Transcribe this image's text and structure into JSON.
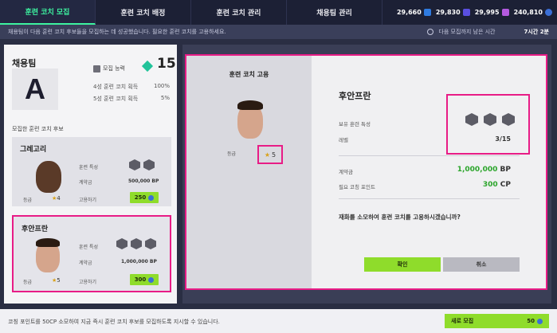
{
  "tabs": [
    "훈련 코치 모집",
    "훈련 코치 배정",
    "훈련 코치 관리",
    "채용팀 관리"
  ],
  "currencies": [
    {
      "value": "29,660",
      "icon": "bp-icon",
      "color": "#2f7be0"
    },
    {
      "value": "29,830",
      "icon": "fc-icon",
      "color": "#5a4fe0"
    },
    {
      "value": "29,995",
      "icon": "mc-icon",
      "color": "#b45ae0"
    },
    {
      "value": "240,810",
      "icon": "cp-icon",
      "color": "#3b6fd6"
    }
  ],
  "info": {
    "message": "채용팀이 다음 훈련 코치 후보들을 모집하는 데 성공했습니다. 필요한 훈련 코치를 고용하세요.",
    "timer_label": "다음 모집까지 남은 시간",
    "timer_value": "7시간 2분"
  },
  "team": {
    "label": "채용팀",
    "grade": "A",
    "recruit_label": "모집 능력",
    "recruit_value": "15",
    "probabilities": [
      {
        "label": "4성 훈련 코치 획득",
        "value": "100%"
      },
      {
        "label": "5성 훈련 코치 획득",
        "value": "5%"
      }
    ]
  },
  "candidates_title": "모집한 훈련 코치 후보",
  "candidates": [
    {
      "name": "그레고리",
      "trait_label": "훈련 특성",
      "fee_label": "계약금",
      "fee": "500,000 BP",
      "grade_label": "등급",
      "stars": "4",
      "hire_label": "고용하기",
      "hire_cost": "250"
    },
    {
      "name": "후안프란",
      "trait_label": "훈련 특성",
      "fee_label": "계약금",
      "fee": "1,000,000 BP",
      "grade_label": "등급",
      "stars": "5",
      "hire_label": "고용하기",
      "hire_cost": "300"
    }
  ],
  "modal": {
    "title": "훈련 코치 고용",
    "grade_label": "등급",
    "stars": "5",
    "name": "후안프란",
    "traits_label": "보유 훈련 특성",
    "level_label": "레벨",
    "level_value": "3/15",
    "fee_label": "계약금",
    "fee_value": "1,000,000",
    "fee_unit": "BP",
    "points_label": "필요 코칭 포인트",
    "points_value": "300",
    "points_unit": "CP",
    "question": "재화를 소모하여 훈련 코치를 고용하시겠습니까?",
    "confirm": "확인",
    "cancel": "취소"
  },
  "bottom": {
    "text": "코칭 포인트를 50CP 소모하여 지금 즉시 훈련 코치 후보를 모집하도록 지시할 수 있습니다.",
    "new_recruit": "새로 모집",
    "new_recruit_cost": "50"
  },
  "colors": {
    "accent_green": "#8fdc2b",
    "highlight": "#e81c86",
    "tab_active": "#3df3a0"
  }
}
